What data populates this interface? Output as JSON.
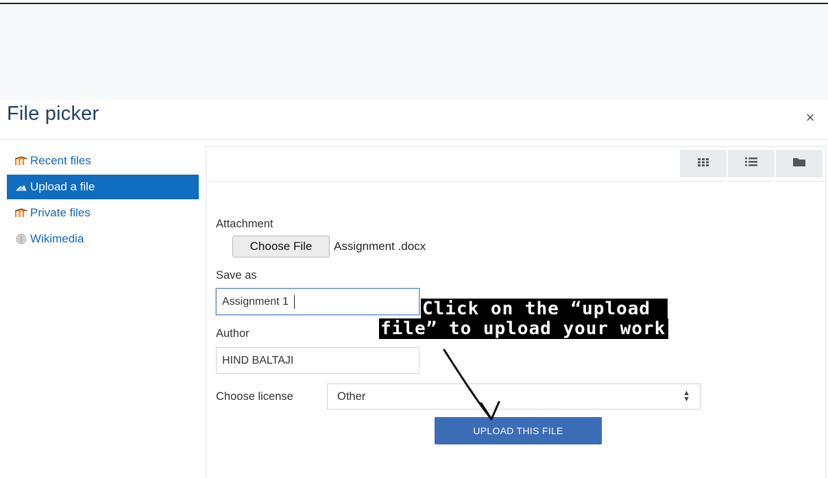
{
  "dialog": {
    "title": "File picker",
    "close_glyph": "×"
  },
  "sidebar": {
    "items": [
      {
        "label": "Recent files",
        "icon": "moodle-icon",
        "active": false
      },
      {
        "label": "Upload a file",
        "icon": "upload-cloud-icon",
        "active": true
      },
      {
        "label": "Private files",
        "icon": "moodle-icon",
        "active": false
      },
      {
        "label": "Wikimedia",
        "icon": "globe-icon",
        "active": false
      }
    ]
  },
  "toolbar": {
    "views": [
      {
        "name": "icons-view",
        "icon": "grid-icon"
      },
      {
        "name": "list-view",
        "icon": "list-icon"
      },
      {
        "name": "tree-view",
        "icon": "folder-icon"
      }
    ]
  },
  "form": {
    "attachment_label": "Attachment",
    "choose_file_label": "Choose File",
    "chosen_file_name": "Assignment .docx",
    "save_as_label": "Save as",
    "save_as_value": "Assignment 1",
    "author_label": "Author",
    "author_value": "HIND BALTAJI",
    "license_label": "Choose license",
    "license_value": "Other",
    "upload_button_label": "UPLOAD THIS FILE"
  },
  "annotation": {
    "line1": "Click on the “upload ",
    "line2": "file” to upload your work"
  },
  "colors": {
    "title": "#1f3f66",
    "active_item_bg": "#0f6cbf",
    "link": "#1565c0",
    "upload_button": "#3a6db5",
    "moodle_orange": "#f98012"
  }
}
